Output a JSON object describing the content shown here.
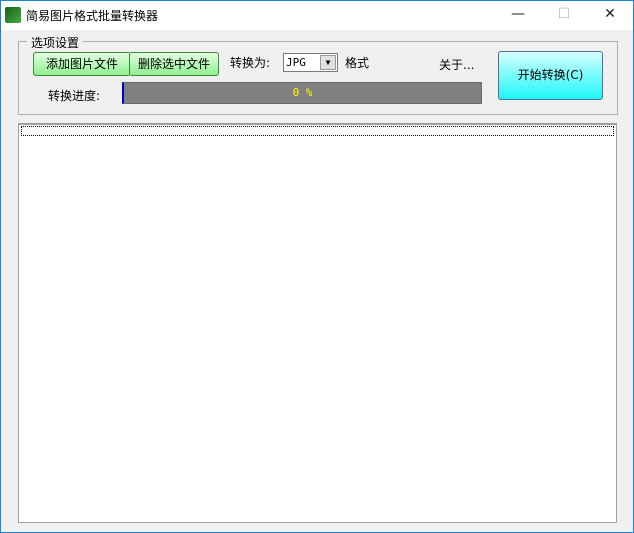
{
  "window": {
    "title": "简易图片格式批量转换器",
    "minimize": "—",
    "maximize": "☐",
    "close": "✕"
  },
  "options": {
    "group_label": "选项设置",
    "add_button": "添加图片文件",
    "delete_button": "删除选中文件",
    "convert_to_label": "转换为:",
    "format_value": "JPG",
    "format_suffix": "格式",
    "about": "关于...",
    "start_button": "开始转换(C)",
    "progress_label": "转换进度:",
    "progress_text": "0 %",
    "progress_value": 0
  },
  "file_list": {
    "items": []
  }
}
